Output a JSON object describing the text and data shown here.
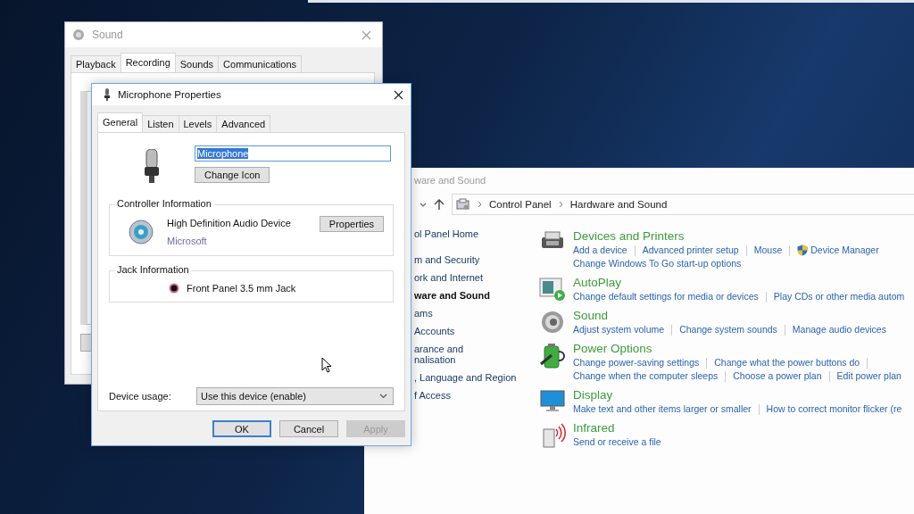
{
  "sound_window": {
    "title": "Sound",
    "tabs": [
      {
        "label": "Playback",
        "selected": false
      },
      {
        "label": "Recording",
        "selected": true
      },
      {
        "label": "Sounds",
        "selected": false
      },
      {
        "label": "Communications",
        "selected": false
      }
    ]
  },
  "properties_dialog": {
    "title": "Microphone Properties",
    "tabs": [
      {
        "label": "General",
        "selected": true
      },
      {
        "label": "Listen",
        "selected": false
      },
      {
        "label": "Levels",
        "selected": false
      },
      {
        "label": "Advanced",
        "selected": false
      }
    ],
    "name_field": {
      "value": "Microphone",
      "text_selected": true
    },
    "change_icon_button": "Change Icon",
    "controller": {
      "heading": "Controller Information",
      "device": "High Definition Audio Device",
      "vendor": "Microsoft",
      "button": "Properties"
    },
    "jack": {
      "heading": "Jack Information",
      "name": "Front Panel 3.5 mm Jack"
    },
    "device_usage": {
      "label": "Device usage:",
      "value": "Use this device (enable)"
    },
    "buttons": [
      {
        "label": "OK",
        "default": true,
        "disabled": false
      },
      {
        "label": "Cancel",
        "default": false,
        "disabled": false
      },
      {
        "label": "Apply",
        "default": false,
        "disabled": true
      }
    ]
  },
  "control_panel": {
    "title": "ware and Sound",
    "breadcrumb": [
      "Control Panel",
      "Hardware and Sound"
    ],
    "sidebar": {
      "items": [
        {
          "label": "ol Panel Home",
          "selected": false
        },
        {
          "label": "m and Security",
          "selected": false
        },
        {
          "label": "ork and Internet",
          "selected": false
        },
        {
          "label": "ware and Sound",
          "selected": true
        },
        {
          "label": "ams",
          "selected": false
        },
        {
          "label": "Accounts",
          "selected": false
        },
        {
          "label": "arance and\nnalisation",
          "selected": false
        },
        {
          "label": ", Language and Region",
          "selected": false
        },
        {
          "label": "f Access",
          "selected": false
        }
      ]
    },
    "categories": [
      {
        "title": "Devices and Printers",
        "rows": [
          [
            {
              "text": "Add a device"
            },
            {
              "text": "Advanced printer setup"
            },
            {
              "text": "Mouse"
            },
            {
              "text": "Device Manager",
              "shield": true
            }
          ],
          [
            {
              "text": "Change Windows To Go start-up options"
            }
          ]
        ]
      },
      {
        "title": "AutoPlay",
        "rows": [
          [
            {
              "text": "Change default settings for media or devices"
            },
            {
              "text": "Play CDs or other media autom"
            }
          ]
        ]
      },
      {
        "title": "Sound",
        "rows": [
          [
            {
              "text": "Adjust system volume"
            },
            {
              "text": "Change system sounds"
            },
            {
              "text": "Manage audio devices"
            }
          ]
        ]
      },
      {
        "title": "Power Options",
        "rows": [
          [
            {
              "text": "Change power-saving settings"
            },
            {
              "text": "Change what the power buttons do"
            }
          ],
          [
            {
              "text": "Change when the computer sleeps"
            },
            {
              "text": "Choose a power plan"
            },
            {
              "text": "Edit power plan"
            }
          ]
        ]
      },
      {
        "title": "Display",
        "rows": [
          [
            {
              "text": "Make text and other items larger or smaller"
            },
            {
              "text": "How to correct monitor flicker (re"
            }
          ]
        ]
      },
      {
        "title": "Infrared",
        "rows": [
          [
            {
              "text": "Send or receive a file"
            }
          ]
        ]
      }
    ]
  }
}
